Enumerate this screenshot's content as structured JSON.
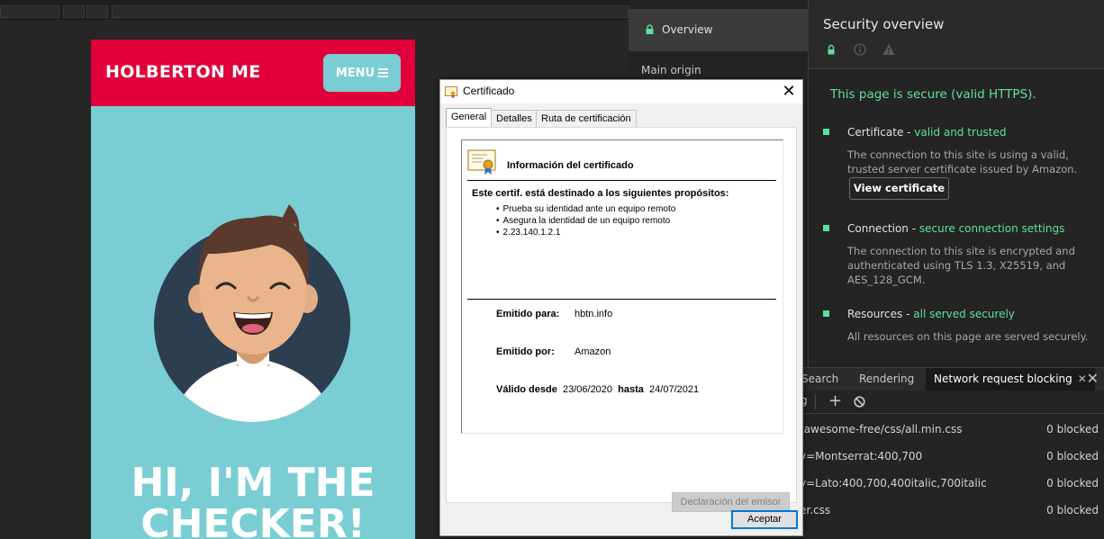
{
  "phone": {
    "brand": "HOLBERTON ME",
    "menu_label": "MENU",
    "hero_line1": "HI, I'M THE",
    "hero_line2": "CHECKER!"
  },
  "dialog": {
    "title": "Certificado",
    "tabs": [
      "General",
      "Detalles",
      "Ruta de certificación"
    ],
    "cert_heading": "Información del certificado",
    "purpose_title": "Este certif. está destinado a los siguientes propósitos:",
    "purposes": [
      "Prueba su identidad ante un equipo remoto",
      "Asegura la identidad de un equipo remoto",
      "2.23.140.1.2.1"
    ],
    "issued_to_label": "Emitido para:",
    "issued_to": "hbtn.info",
    "issued_by_label": "Emitido por:",
    "issued_by": "Amazon",
    "valid_from_label": "Válido desde",
    "valid_from": "23/06/2020",
    "valid_to_label": "hasta",
    "valid_to": "24/07/2021",
    "issuer_statement": "Declaración del emisor",
    "accept": "Aceptar"
  },
  "security": {
    "side_overview": "Overview",
    "side_main_origin": "Main origin",
    "title": "Security overview",
    "secure_msg": "This page is secure (valid HTTPS).",
    "certificate_label": "Certificate - ",
    "certificate_status": "valid and trusted",
    "certificate_desc": "The connection to this site is using a valid, trusted server certificate issued by Amazon.",
    "view_certificate": "View certificate",
    "connection_label": "Connection - ",
    "connection_status": "secure connection settings",
    "connection_desc": "The connection to this site is encrypted and authenticated using TLS 1.3, X25519, and AES_128_GCM.",
    "resources_label": "Resources - ",
    "resources_status": "all served securely",
    "resources_desc": "All resources on this page are served securely.",
    "accent": "#5fe098"
  },
  "drawer": {
    "tab_search": "Search",
    "tab_rendering": "Rendering",
    "tab_blocking": "Network request blocking",
    "toolbar_fragment": "g",
    "rows": [
      {
        "pattern": "tawesome-free/css/all.min.css",
        "count": "0 blocked"
      },
      {
        "pattern": "y=Montserrat:400,700",
        "count": "0 blocked"
      },
      {
        "pattern": "y=Lato:400,700,400italic,700italic",
        "count": "0 blocked"
      },
      {
        "pattern": "er.css",
        "count": "0 blocked"
      }
    ]
  }
}
